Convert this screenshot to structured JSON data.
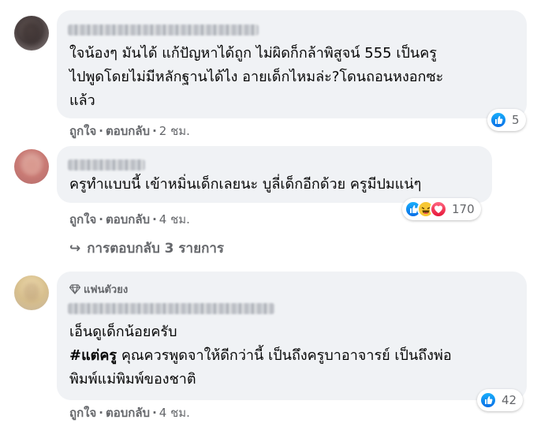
{
  "comments": [
    {
      "text": "ใจน้องๆ มันได้ แก้ปัญหาได้ถูก ไม่ผิดก็กล้าพิสูจน์ 555 เป็นครู\nไปพูดโดยไม่มีหลักฐานได้ไง อายเด็กไหมล่ะ?โดนถอนหงอกซะ\nแล้ว",
      "like_label": "ถูกใจ",
      "reply_label": "ตอบกลับ",
      "time": "2 ชม.",
      "reaction_count": "5",
      "reactions": [
        "like-icon"
      ]
    },
    {
      "text": "ครูทำแบบนี้ เข้าหมิ่นเด็กเลยนะ บูลี่เด็กอีกด้วย ครูมีปมแน่ๆ",
      "like_label": "ถูกใจ",
      "reply_label": "ตอบกลับ",
      "time": "4 ชม.",
      "reaction_count": "170",
      "reactions": [
        "like-icon",
        "haha-icon",
        "love-icon"
      ],
      "replies_label": "การตอบกลับ 3 รายการ"
    },
    {
      "badge": "แฟนตัวยง",
      "text_line1": "เอ็นดูเด็กน้อยครับ",
      "hashtag": "#แต่ครู",
      "text_line2": " คุณควรพูดจาให้ดีกว่านี้ เป็นถึงครูบาอาจารย์ เป็นถึงพ่อ",
      "text_line3": "พิมพ์แม่พิมพ์ของชาติ",
      "like_label": "ถูกใจ",
      "reply_label": "ตอบกลับ",
      "time": "4 ชม.",
      "reaction_count": "42",
      "reactions": [
        "like-icon"
      ]
    }
  ],
  "colors": {
    "bubble": "#f0f2f5",
    "meta_text": "#65676b",
    "like_blue": "#1877f2"
  }
}
